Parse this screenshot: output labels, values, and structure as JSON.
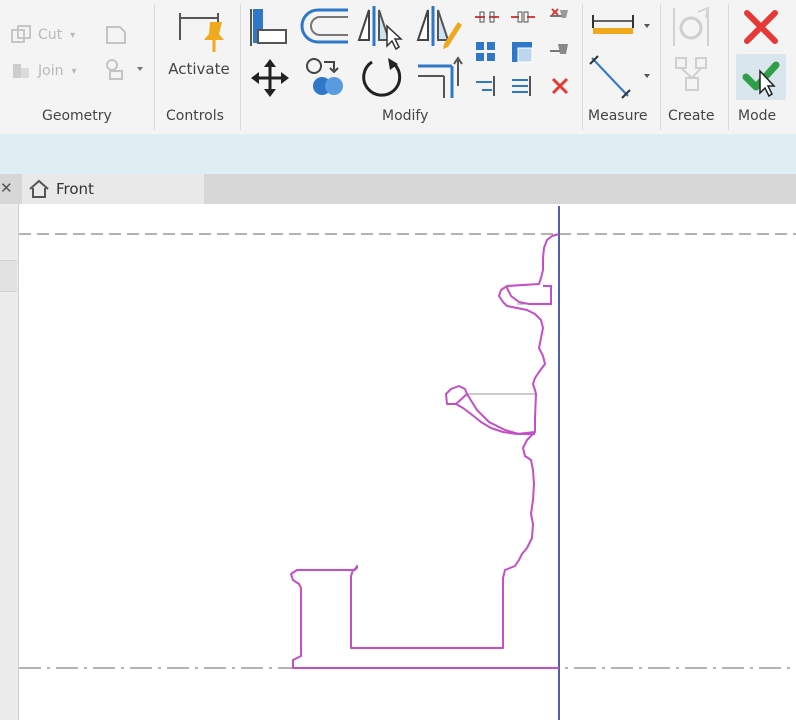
{
  "ribbon": {
    "geometry": {
      "label": "Geometry",
      "cut_label": "Cut",
      "join_label": "Join"
    },
    "controls": {
      "label": "Controls",
      "activate_label": "Activate"
    },
    "modify": {
      "label": "Modify"
    },
    "measure": {
      "label": "Measure"
    },
    "create": {
      "label": "Create"
    },
    "mode": {
      "label": "Mode"
    }
  },
  "view_tab": {
    "title": "Front",
    "icon": "home-icon"
  },
  "colors": {
    "sketch_line": "#c44fc8",
    "reference_plane": "#3b4fa8",
    "cancel_red": "#e53935",
    "finish_green": "#2e9e48",
    "ribbon_bg": "#f4f4f4",
    "options_bar": "#dfeef3"
  }
}
